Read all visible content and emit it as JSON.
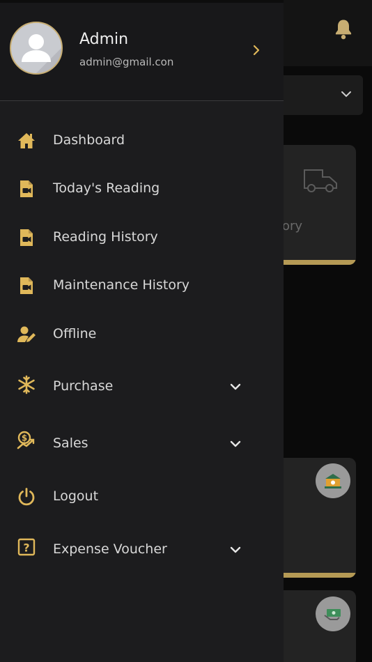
{
  "colors": {
    "accent": "#e0b85a",
    "drawer_bg": "#1c1c1e",
    "text": "#d8d8d8",
    "card_bar": "#b59a55"
  },
  "profile": {
    "name": "Admin",
    "email": "admin@gmail.con",
    "avatar_icon": "user-avatar-icon",
    "chevron_icon": "chevron-right-icon"
  },
  "menu": {
    "items": [
      {
        "label": "Dashboard",
        "icon": "home-icon",
        "expandable": false
      },
      {
        "label": "Today's Reading",
        "icon": "video-file-icon",
        "expandable": false
      },
      {
        "label": "Reading History",
        "icon": "video-file-icon",
        "expandable": false
      },
      {
        "label": "Maintenance History",
        "icon": "video-file-icon",
        "expandable": false
      },
      {
        "label": "Offline",
        "icon": "user-edit-icon",
        "expandable": false
      },
      {
        "label": "Purchase",
        "icon": "snowflake-icon",
        "expandable": true
      },
      {
        "label": "Sales",
        "icon": "sales-chart-icon",
        "expandable": true
      },
      {
        "label": "Logout",
        "icon": "power-icon",
        "expandable": false
      },
      {
        "label": "Expense Voucher",
        "icon": "question-box-icon",
        "expandable": true
      }
    ]
  },
  "background": {
    "card_partial_text": "ory",
    "icons": [
      "bell-icon",
      "chevron-down-icon",
      "truck-icon",
      "bank-icon",
      "cash-icon"
    ]
  }
}
